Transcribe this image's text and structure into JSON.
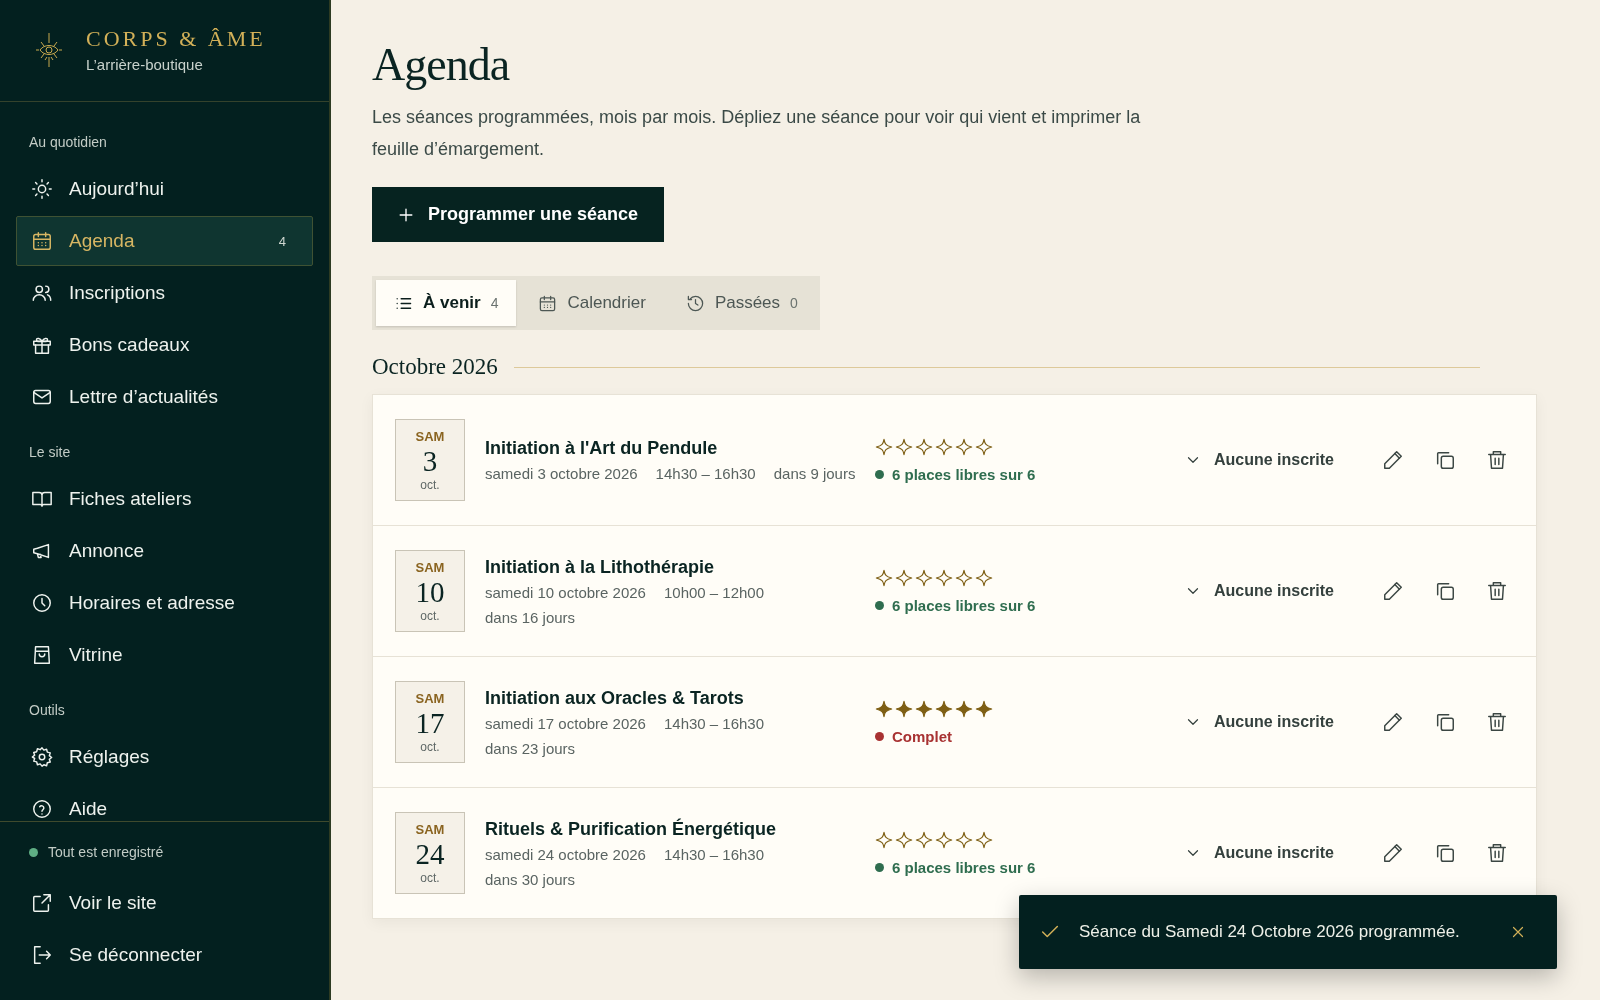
{
  "brand": {
    "name": "CORPS & ÂME",
    "subtitle": "L’arrière-boutique"
  },
  "sidebar": {
    "sections": [
      {
        "title": "Au quotidien",
        "items": [
          {
            "kind": "sun",
            "label": "Aujourd’hui",
            "selected": false
          },
          {
            "kind": "calendar",
            "label": "Agenda",
            "selected": true,
            "badge": "4"
          },
          {
            "kind": "users",
            "label": "Inscriptions",
            "selected": false
          },
          {
            "kind": "gift",
            "label": "Bons cadeaux",
            "selected": false
          },
          {
            "kind": "mail",
            "label": "Lettre d’actualités",
            "selected": false
          }
        ]
      },
      {
        "title": "Le site",
        "items": [
          {
            "kind": "book",
            "label": "Fiches ateliers",
            "selected": false
          },
          {
            "kind": "megaphone",
            "label": "Annonce",
            "selected": false
          },
          {
            "kind": "clock",
            "label": "Horaires et adresse",
            "selected": false
          },
          {
            "kind": "bag",
            "label": "Vitrine",
            "selected": false
          }
        ]
      },
      {
        "title": "Outils",
        "items": [
          {
            "kind": "gear",
            "label": "Réglages",
            "selected": false
          },
          {
            "kind": "help",
            "label": "Aide",
            "selected": false
          }
        ]
      }
    ],
    "status": {
      "text": "Tout est enregistré",
      "color": "#5fae84"
    },
    "links": [
      {
        "kind": "external",
        "label": "Voir le site"
      },
      {
        "kind": "logout",
        "label": "Se déconnecter"
      }
    ]
  },
  "page": {
    "title": "Agenda",
    "intro": "Les séances programmées, mois par mois. Dépliez une séance pour voir qui vient et imprimer la feuille d’émargement.",
    "primary_button": "Programmer une séance"
  },
  "tabs": [
    {
      "kind": "list",
      "label": "À venir",
      "count": "4",
      "selected": true
    },
    {
      "kind": "calendar",
      "label": "Calendrier",
      "selected": false
    },
    {
      "kind": "history",
      "label": "Passées",
      "count": "0",
      "selected": false
    }
  ],
  "month": "Octobre 2026",
  "sessions": [
    {
      "weekday": "SAM",
      "day": "3",
      "month": "oct.",
      "title": "Initiation à l'Art du Pendule",
      "date": "samedi 3 octobre 2026",
      "time": "14h30 – 16h30",
      "relative": "dans 9 jours",
      "stars": 0,
      "availability": {
        "kind": "open",
        "text": "6 places libres sur 6"
      },
      "signups": "Aucune inscrite",
      "expanded": false
    },
    {
      "weekday": "SAM",
      "day": "10",
      "month": "oct.",
      "title": "Initiation à la Lithothérapie",
      "date": "samedi 10 octobre 2026",
      "time": "10h00 – 12h00",
      "relative": "dans 16 jours",
      "stars": 0,
      "availability": {
        "kind": "open",
        "text": "6 places libres sur 6"
      },
      "signups": "Aucune inscrite",
      "expanded": false
    },
    {
      "weekday": "SAM",
      "day": "17",
      "month": "oct.",
      "title": "Initiation aux Oracles & Tarots",
      "date": "samedi 17 octobre 2026",
      "time": "14h30 – 16h30",
      "relative": "dans 23 jours",
      "stars": 6,
      "availability": {
        "kind": "full",
        "text": "Complet"
      },
      "signups": "Aucune inscrite",
      "expanded": false
    },
    {
      "weekday": "SAM",
      "day": "24",
      "month": "oct.",
      "title": "Rituels & Purification Énergétique",
      "date": "samedi 24 octobre 2026",
      "time": "14h30 – 16h30",
      "relative": "dans 30 jours",
      "stars": 0,
      "availability": {
        "kind": "open",
        "text": "6 places libres sur 6"
      },
      "signups": "Aucune inscrite",
      "expanded": false
    }
  ],
  "toast": {
    "text": "Séance du Samedi 24 Octobre 2026 programmée."
  }
}
